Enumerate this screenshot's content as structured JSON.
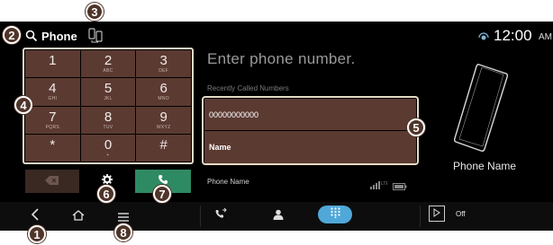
{
  "header": {
    "title": "Phone",
    "clock": "12:00",
    "ampm": "AM"
  },
  "keypad": {
    "keys": [
      {
        "digit": "1",
        "letters": ""
      },
      {
        "digit": "2",
        "letters": "ABC"
      },
      {
        "digit": "3",
        "letters": "DEF"
      },
      {
        "digit": "4",
        "letters": "GHI"
      },
      {
        "digit": "5",
        "letters": "JKL"
      },
      {
        "digit": "6",
        "letters": "MNO"
      },
      {
        "digit": "7",
        "letters": "PQRS"
      },
      {
        "digit": "8",
        "letters": "TUV"
      },
      {
        "digit": "9",
        "letters": "WXYZ"
      },
      {
        "digit": "*",
        "letters": ""
      },
      {
        "digit": "0",
        "letters": "+"
      },
      {
        "digit": "#",
        "letters": ""
      }
    ]
  },
  "main": {
    "number_placeholder": "Enter phone number.",
    "recent_label": "Recently Called Numbers",
    "recent_number": "00000000000",
    "recent_name": "Name",
    "phone_name_status": "Phone Name"
  },
  "device": {
    "name": "Phone Name"
  },
  "bottom_bar": {
    "off_label": "Off"
  },
  "callouts": [
    "1",
    "2",
    "3",
    "4",
    "5",
    "6",
    "7",
    "8"
  ],
  "colors": {
    "key_bg": "#5b3a32",
    "call_green": "#2e8a62",
    "dial_tab_blue": "#4fa8d8",
    "outline": "#e7dbc7",
    "callout_bg": "#4f3429"
  }
}
